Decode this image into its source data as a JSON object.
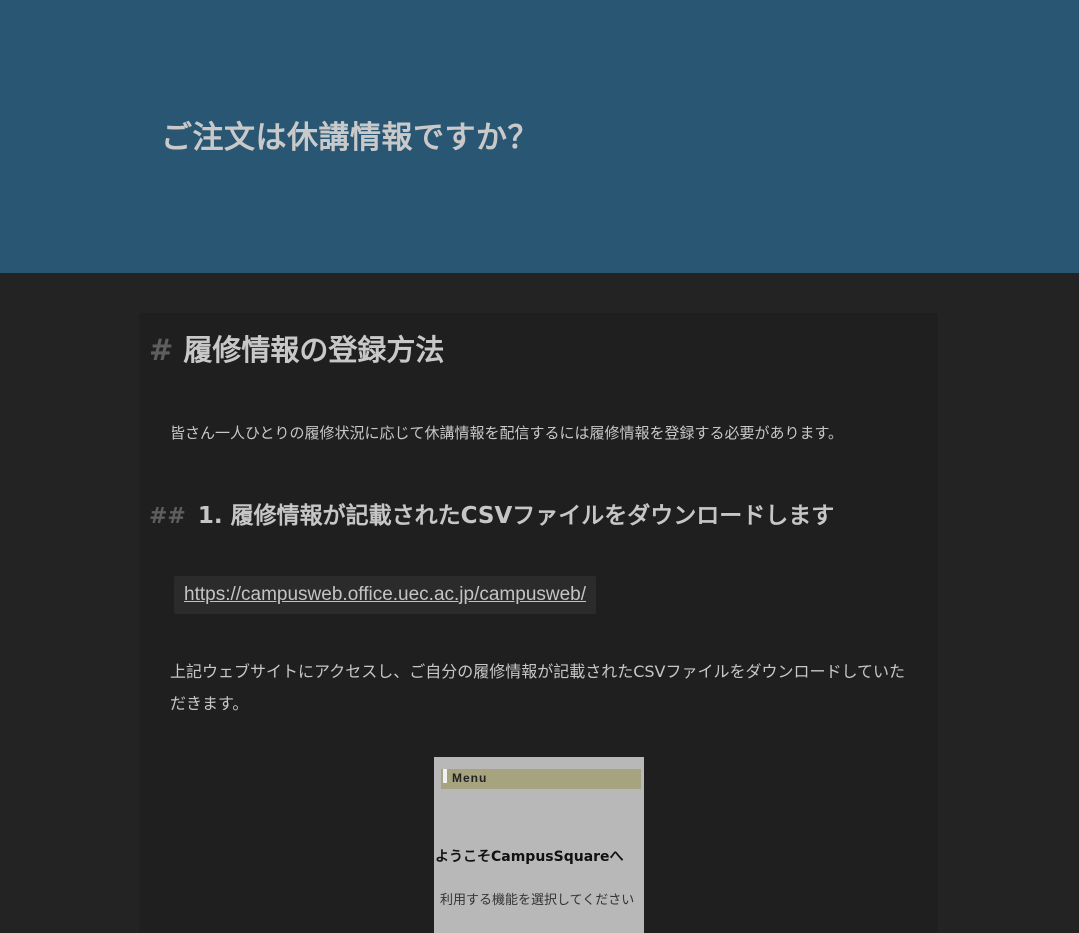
{
  "site": {
    "title": "ご注文は休講情報ですか？"
  },
  "article": {
    "h1_hash": "#",
    "h1": "履修情報の登録方法",
    "intro": "皆さん一人ひとりの履修状況に応じて休講情報を配信するには履修情報を登録する必要があります。",
    "h2_hash": "##",
    "h2": "1. 履修情報が記載されたCSVファイルをダウンロードします",
    "link": "https://campusweb.office.uec.ac.jp/campusweb/",
    "instruction": "上記ウェブサイトにアクセスし、ご自分の履修情報が記載されたCSVファイルをダウンロードしていただきます。"
  },
  "screenshot": {
    "menu_label": "Menu",
    "welcome": "ようこそCampusSquareへ",
    "subtitle": "利用する機能を選択してください"
  },
  "colors": {
    "header_bg": "#295673",
    "page_bg": "#232323",
    "card_bg": "#1f1f1f"
  }
}
